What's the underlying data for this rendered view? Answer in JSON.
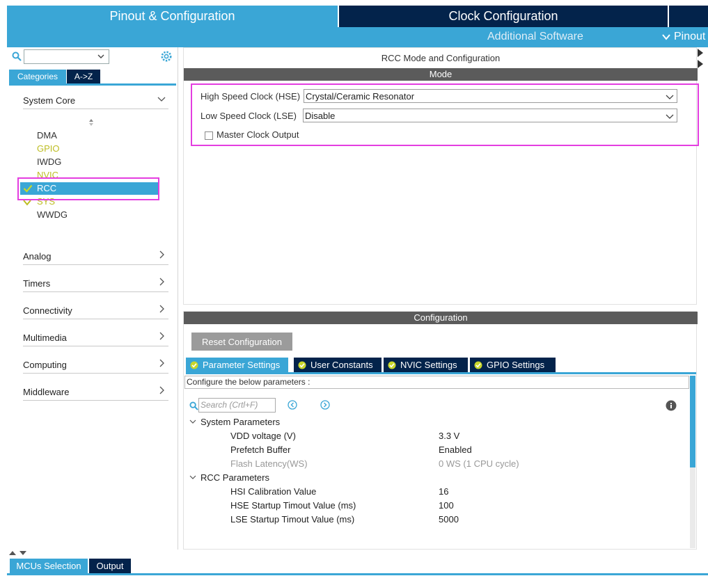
{
  "top_tabs": {
    "pinout": "Pinout & Configuration",
    "clock": "Clock Configuration",
    "additional_software": "Additional Software",
    "pinout_view": "Pinout"
  },
  "left": {
    "tabs": {
      "categories": "Categories",
      "az": "A->Z"
    },
    "sections": {
      "system_core": "System Core",
      "analog": "Analog",
      "timers": "Timers",
      "connectivity": "Connectivity",
      "multimedia": "Multimedia",
      "computing": "Computing",
      "middleware": "Middleware"
    },
    "peripherals": {
      "dma": "DMA",
      "gpio": "GPIO",
      "iwdg": "IWDG",
      "nvic": "NVIC",
      "rcc": "RCC",
      "sys": "SYS",
      "wwdg": "WWDG"
    }
  },
  "mode_panel": {
    "title": "RCC Mode and Configuration",
    "header": "Mode",
    "hse_label": "High Speed Clock (HSE)",
    "hse_value": "Crystal/Ceramic Resonator",
    "lse_label": "Low Speed Clock (LSE)",
    "lse_value": "Disable",
    "mco_label": "Master Clock Output"
  },
  "config_panel": {
    "header": "Configuration",
    "reset_button": "Reset Configuration",
    "tabs": {
      "parameter": "Parameter Settings",
      "user": "User Constants",
      "nvic": "NVIC Settings",
      "gpio": "GPIO Settings"
    },
    "hint": "Configure the below parameters :",
    "search_placeholder": "Search (Crtl+F)",
    "groups": {
      "system": "System Parameters",
      "rcc": "RCC Parameters"
    },
    "params": {
      "vdd_label": "VDD voltage (V)",
      "vdd_value": "3.3 V",
      "prefetch_label": "Prefetch Buffer",
      "prefetch_value": "Enabled",
      "flash_label": "Flash Latency(WS)",
      "flash_value": "0 WS (1 CPU cycle)",
      "hsi_label": "HSI Calibration Value",
      "hsi_value": "16",
      "hse_label": "HSE Startup Timout Value (ms)",
      "hse_value": "100",
      "lse_label": "LSE Startup Timout Value (ms)",
      "lse_value": "5000"
    }
  },
  "bottom_tabs": {
    "mcu": "MCUs Selection",
    "output": "Output"
  },
  "colors": {
    "accent": "#3aa6d6",
    "dark": "#03234b",
    "highlight": "#e43ee0",
    "configured_yellow": "#bdbd22"
  }
}
